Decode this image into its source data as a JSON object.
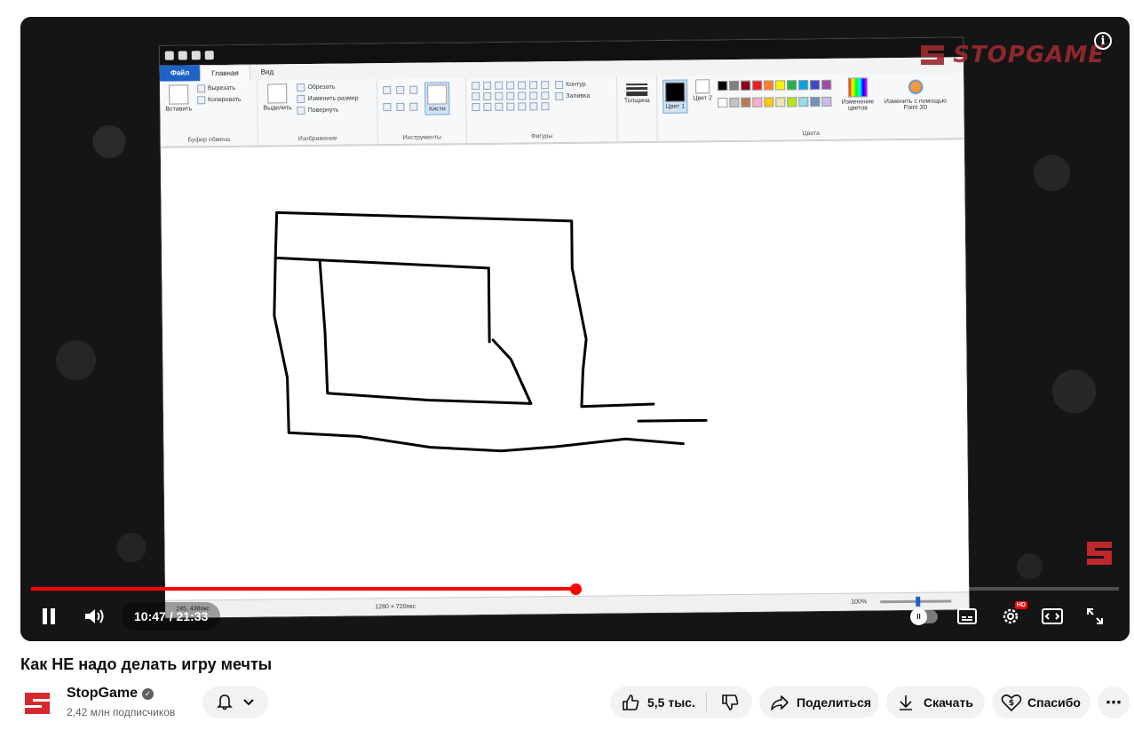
{
  "player": {
    "watermark_text": "STOPGAME",
    "current_time": "10:47",
    "duration": "21:33",
    "time_display": "10:47 / 21:33",
    "progress_fraction": 0.5,
    "buffered_fraction": 0.525,
    "hd_badge": "HD",
    "accent_color": "#ff0000"
  },
  "paint": {
    "tabs": [
      "Файл",
      "Главная",
      "Вид"
    ],
    "groups": {
      "clipboard": {
        "label": "Буфер обмена",
        "paste": "Вставить",
        "cut": "Вырезать",
        "copy": "Копировать"
      },
      "image": {
        "label": "Изображение",
        "select": "Выделить",
        "crop": "Обрезать",
        "resize": "Изменить размер",
        "rotate": "Повернуть"
      },
      "tools": {
        "label": "Инструменты",
        "brushes": "Кисти"
      },
      "shapes": {
        "label": "Фигуры",
        "outline": "Контур",
        "fill": "Заливка"
      },
      "size": {
        "label": "Толщина"
      },
      "colors": {
        "label": "Цвета",
        "color1": "Цвет 1",
        "color2": "Цвет 2",
        "edit": "Изменение цветов",
        "paint3d": "Изменить с помощью Paint 3D"
      }
    },
    "palette": [
      "#000000",
      "#7f7f7f",
      "#880015",
      "#ed1c24",
      "#ff7f27",
      "#fff200",
      "#22b14c",
      "#00a2e8",
      "#3f48cc",
      "#a349a4",
      "#ffffff",
      "#c3c3c3",
      "#b97a57",
      "#ffaec9",
      "#ffc90e",
      "#efe4b0",
      "#b5e61d",
      "#99d9ea",
      "#7092be",
      "#c8bfe7"
    ],
    "status": {
      "cursor_pos": "245, 438пкс",
      "canvas_size": "1280 × 720пкс",
      "zoom": "100%"
    }
  },
  "video": {
    "title": "Как НЕ надо делать игру мечты",
    "channel_name": "StopGame",
    "subscribers": "2,42 млн подписчиков",
    "likes": "5,5 тыс.",
    "share_label": "Поделиться",
    "download_label": "Скачать",
    "thanks_label": "Спасибо"
  }
}
